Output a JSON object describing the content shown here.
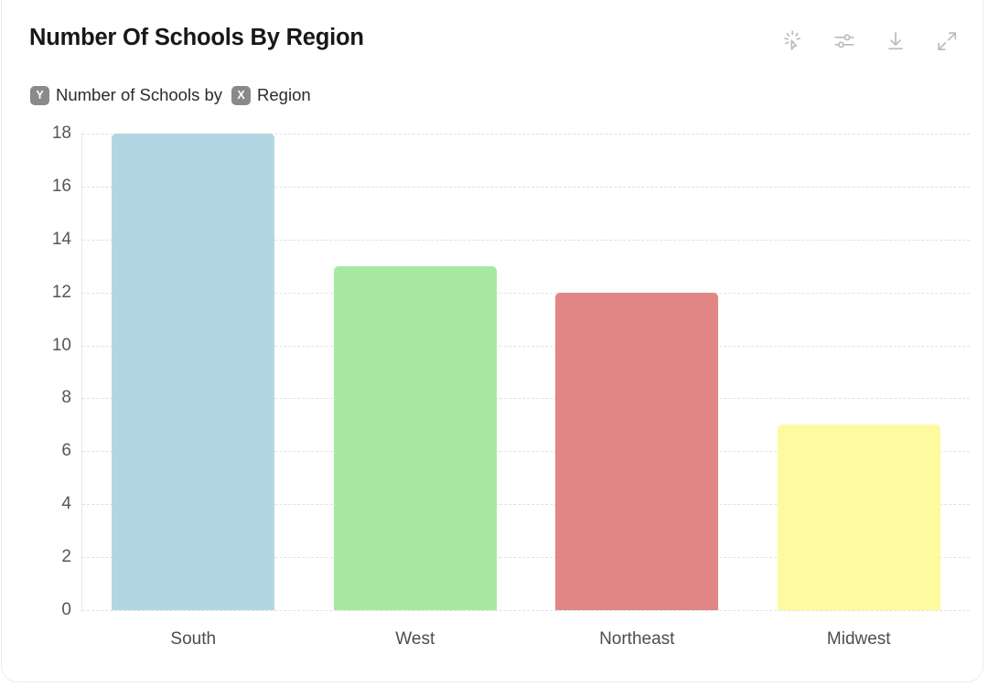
{
  "card": {
    "title": "Number Of Schools By Region",
    "subtitle": {
      "y_badge": "Y",
      "y_text": "Number of Schools by",
      "x_badge": "X",
      "x_text": "Region"
    }
  },
  "toolbar": {
    "items": [
      {
        "name": "magic-insight-icon",
        "label": "Magic insight"
      },
      {
        "name": "sliders-settings-icon",
        "label": "Chart settings"
      },
      {
        "name": "download-icon",
        "label": "Download"
      },
      {
        "name": "expand-icon",
        "label": "Expand"
      }
    ]
  },
  "colors": {
    "bar_south": "#b2d7e3",
    "bar_west": "#a7e9a0",
    "bar_northeast": "#e08785",
    "bar_midwest": "#fdfaa0",
    "gridline": "#e0e0e0",
    "axis_text": "#565656",
    "title_text": "#181818",
    "badge_bg": "#8a8a8a"
  },
  "chart_data": {
    "type": "bar",
    "title": "Number Of Schools By Region",
    "xlabel": "Region",
    "ylabel": "Number of Schools",
    "categories": [
      "South",
      "West",
      "Northeast",
      "Midwest"
    ],
    "values": [
      18,
      13,
      12,
      7
    ],
    "colors": [
      "#b2d7e3",
      "#a7e9a0",
      "#e08785",
      "#fdfaa0"
    ],
    "ylim": [
      0,
      18
    ],
    "yticks": [
      0,
      2,
      4,
      6,
      8,
      10,
      12,
      14,
      16,
      18
    ],
    "ytick_labels": [
      "0",
      "2",
      "4",
      "6",
      "8",
      "10",
      "12",
      "14",
      "16",
      "18"
    ],
    "grid": true,
    "grid_style": "dashed",
    "legend": false
  }
}
